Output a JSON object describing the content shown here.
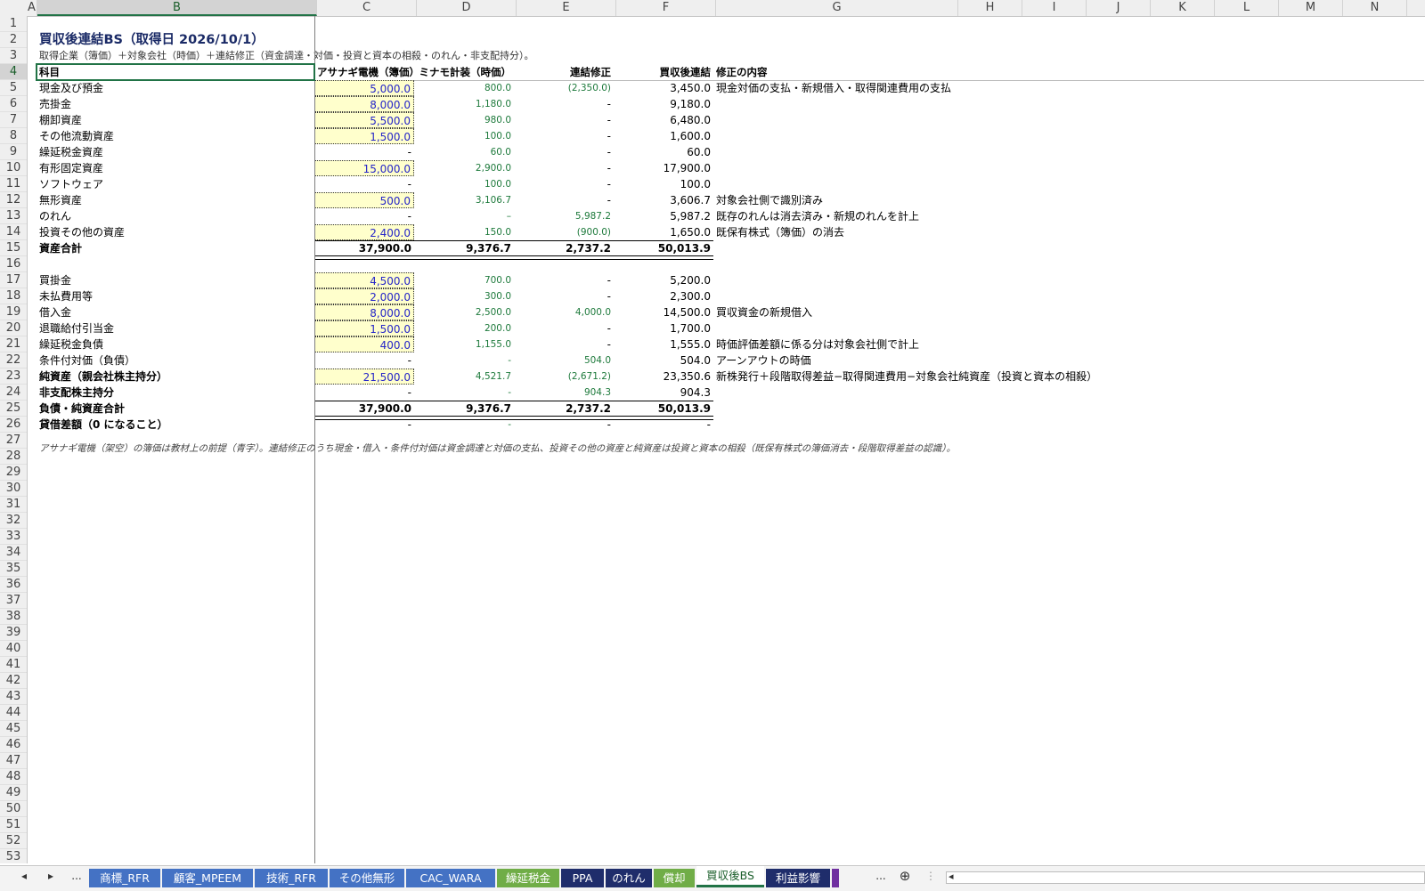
{
  "columns": [
    "A",
    "B",
    "C",
    "D",
    "E",
    "F",
    "G",
    "H",
    "I",
    "J",
    "K",
    "L",
    "M",
    "N"
  ],
  "rows_count": 53,
  "title": "買収後連結BS（取得日 2026/10/1）",
  "subtitle": "取得企業（簿価）＋対象会社（時価）＋連結修正（資金調達・対価・投資と資本の相殺・のれん・非支配持分）。",
  "headers": [
    "科目",
    "アサナギ電機（簿価）",
    "ミナモ計装（時価）",
    "連結修正",
    "買収後連結",
    "修正の内容"
  ],
  "table": [
    {
      "row": 5,
      "item": "現金及び預金",
      "c": "5,000.0",
      "d": "800.0",
      "e": "(2,350.0)",
      "f": "3,450.0",
      "g": "現金対価の支払・新規借入・取得関連費用の支払",
      "input": true
    },
    {
      "row": 6,
      "item": "売掛金",
      "c": "8,000.0",
      "d": "1,180.0",
      "e": "-",
      "f": "9,180.0",
      "g": "",
      "input": true
    },
    {
      "row": 7,
      "item": "棚卸資産",
      "c": "5,500.0",
      "d": "980.0",
      "e": "-",
      "f": "6,480.0",
      "g": "",
      "input": true
    },
    {
      "row": 8,
      "item": "その他流動資産",
      "c": "1,500.0",
      "d": "100.0",
      "e": "-",
      "f": "1,600.0",
      "g": "",
      "input": true
    },
    {
      "row": 9,
      "item": "繰延税金資産",
      "c": "-",
      "d": "60.0",
      "e": "-",
      "f": "60.0",
      "g": "",
      "input": false
    },
    {
      "row": 10,
      "item": "有形固定資産",
      "c": "15,000.0",
      "d": "2,900.0",
      "e": "-",
      "f": "17,900.0",
      "g": "",
      "input": true
    },
    {
      "row": 11,
      "item": "ソフトウェア",
      "c": "-",
      "d": "100.0",
      "e": "-",
      "f": "100.0",
      "g": "",
      "input": false
    },
    {
      "row": 12,
      "item": "無形資産",
      "c": "500.0",
      "d": "3,106.7",
      "e": "-",
      "f": "3,606.7",
      "g": "対象会社側で識別済み",
      "input": true
    },
    {
      "row": 13,
      "item": "のれん",
      "c": "-",
      "d": "–",
      "e": "5,987.2",
      "f": "5,987.2",
      "g": "既存のれんは消去済み・新規のれんを計上",
      "input": false
    },
    {
      "row": 14,
      "item": "投資その他の資産",
      "c": "2,400.0",
      "d": "150.0",
      "e": "(900.0)",
      "f": "1,650.0",
      "g": "既保有株式（簿価）の消去",
      "input": true
    },
    {
      "row": 15,
      "item": "資産合計",
      "c": "37,900.0",
      "d": "9,376.7",
      "e": "2,737.2",
      "f": "50,013.9",
      "g": "",
      "input": false,
      "total": true
    },
    {
      "row": 17,
      "item": "買掛金",
      "c": "4,500.0",
      "d": "700.0",
      "e": "-",
      "f": "5,200.0",
      "g": "",
      "input": true
    },
    {
      "row": 18,
      "item": "未払費用等",
      "c": "2,000.0",
      "d": "300.0",
      "e": "-",
      "f": "2,300.0",
      "g": "",
      "input": true
    },
    {
      "row": 19,
      "item": "借入金",
      "c": "8,000.0",
      "d": "2,500.0",
      "e": "4,000.0",
      "f": "14,500.0",
      "g": "買収資金の新規借入",
      "input": true
    },
    {
      "row": 20,
      "item": "退職給付引当金",
      "c": "1,500.0",
      "d": "200.0",
      "e": "-",
      "f": "1,700.0",
      "g": "",
      "input": true
    },
    {
      "row": 21,
      "item": "繰延税金負債",
      "c": "400.0",
      "d": "1,155.0",
      "e": "-",
      "f": "1,555.0",
      "g": "時価評価差額に係る分は対象会社側で計上",
      "input": true
    },
    {
      "row": 22,
      "item": "条件付対価（負債）",
      "c": "-",
      "d": "-",
      "e": "504.0",
      "f": "504.0",
      "g": "アーンアウトの時価",
      "input": false
    },
    {
      "row": 23,
      "item": "純資産（親会社株主持分）",
      "c": "21,500.0",
      "d": "4,521.7",
      "e": "(2,671.2)",
      "f": "23,350.6",
      "g": "新株発行＋段階取得差益−取得関連費用−対象会社純資産（投資と資本の相殺）",
      "input": true,
      "bold": true
    },
    {
      "row": 24,
      "item": "非支配株主持分",
      "c": "-",
      "d": "-",
      "e": "904.3",
      "f": "904.3",
      "g": "",
      "input": false,
      "bold": true
    },
    {
      "row": 25,
      "item": "負債・純資産合計",
      "c": "37,900.0",
      "d": "9,376.7",
      "e": "2,737.2",
      "f": "50,013.9",
      "g": "",
      "input": false,
      "total": true
    },
    {
      "row": 26,
      "item": "貸借差額（0 になること）",
      "c": "-",
      "d": "-",
      "e": "-",
      "f": "-",
      "g": "",
      "input": false,
      "bold": true
    }
  ],
  "footnote": "アサナギ電機（架空）の簿価は教材上の前提（青字）。連結修正のうち現金・借入・条件付対価は資金調達と対価の支払、投資その他の資産と純資産は投資と資本の相殺（既保有株式の簿価消去・段階取得差益の認識）。",
  "tabs": [
    {
      "label": "商標_RFR",
      "color": "#4472c4"
    },
    {
      "label": "顧客_MPEEM",
      "color": "#4472c4"
    },
    {
      "label": "技術_RFR",
      "color": "#4472c4"
    },
    {
      "label": "その他無形",
      "color": "#4472c4"
    },
    {
      "label": "CAC_WARA",
      "color": "#4472c4"
    },
    {
      "label": "繰延税金",
      "color": "#70ad47"
    },
    {
      "label": "PPA",
      "color": "#1f2d6b"
    },
    {
      "label": "のれん",
      "color": "#1f2d6b"
    },
    {
      "label": "償却",
      "color": "#70ad47"
    },
    {
      "label": "買収後BS",
      "color": "#ffffff",
      "active": true
    },
    {
      "label": "利益影響",
      "color": "#1f2d6b"
    }
  ],
  "nav": {
    "prev": "◂",
    "next": "▸",
    "more": "...",
    "more2": "...",
    "add": "⊕",
    "split": "⋮",
    "scroll_left": "◂"
  },
  "colors": {
    "accent": "#217346",
    "input_fill": "#ffffcc",
    "input_text": "#2626c8",
    "calc_text": "#1e7a3c"
  }
}
